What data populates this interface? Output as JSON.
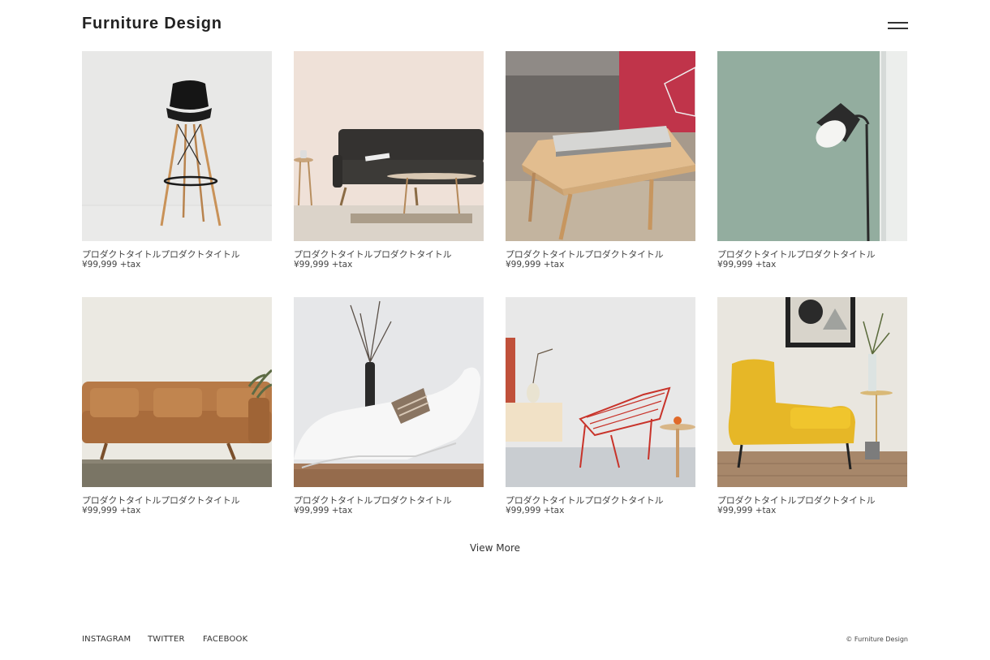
{
  "header": {
    "logo": "Furniture Design",
    "menu_icon": "hamburger-menu-icon"
  },
  "products": [
    {
      "image": "black-bar-stool",
      "title": "プロダクトタイトルプロダクトタイトル",
      "price": "¥99,999 +tax"
    },
    {
      "image": "dark-gray-sofa-with-coffee-table",
      "title": "プロダクトタイトルプロダクトタイトル",
      "price": "¥99,999 +tax"
    },
    {
      "image": "wooden-side-table-with-books",
      "title": "プロダクトタイトルプロダクトタイトル",
      "price": "¥99,999 +tax"
    },
    {
      "image": "black-floor-lamp-on-green-wall",
      "title": "プロダクトタイトルプロダクトタイトル",
      "price": "¥99,999 +tax"
    },
    {
      "image": "brown-leather-sofa",
      "title": "プロダクトタイトルプロダクトタイトル",
      "price": "¥99,999 +tax"
    },
    {
      "image": "white-chaise-lounge",
      "title": "プロダクトタイトルプロダクトタイトル",
      "price": "¥99,999 +tax"
    },
    {
      "image": "red-wire-chair",
      "title": "プロダクトタイトルプロダクトタイトル",
      "price": "¥99,999 +tax"
    },
    {
      "image": "yellow-armchair",
      "title": "プロダクトタイトルプロダクトタイトル",
      "price": "¥99,999 +tax"
    }
  ],
  "view_more": "View More",
  "footer": {
    "links": [
      "INSTAGRAM",
      "TWITTER",
      "FACEBOOK"
    ],
    "copyright": "© Furniture Design"
  }
}
